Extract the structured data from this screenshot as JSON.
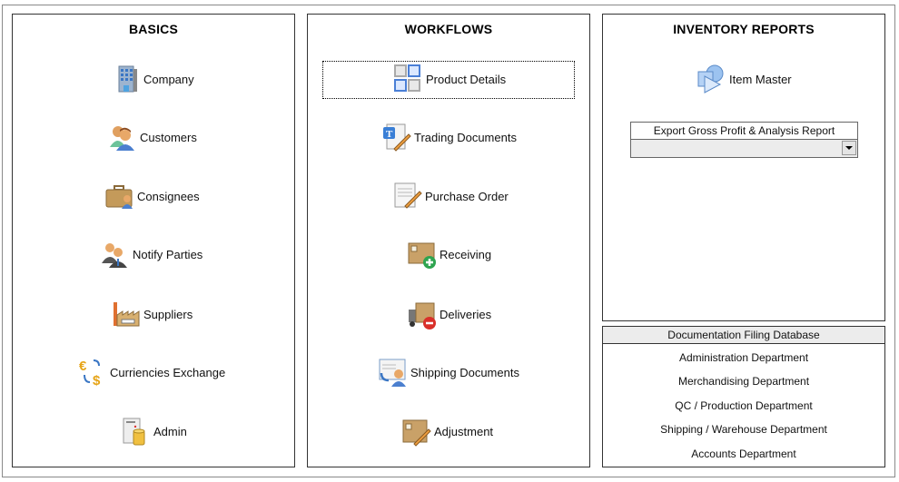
{
  "basics": {
    "title": "BASICS",
    "items": [
      {
        "label": "Company",
        "icon": "building-icon"
      },
      {
        "label": "Customers",
        "icon": "users-icon"
      },
      {
        "label": "Consignees",
        "icon": "briefcase-user-icon"
      },
      {
        "label": "Notify Parties",
        "icon": "business-people-icon"
      },
      {
        "label": "Suppliers",
        "icon": "factory-icon"
      },
      {
        "label": "Curriencies Exchange",
        "icon": "currency-exchange-icon"
      },
      {
        "label": "Admin",
        "icon": "server-database-icon"
      }
    ]
  },
  "workflows": {
    "title": "WORKFLOWS",
    "items": [
      {
        "label": "Product Details",
        "icon": "grid-squares-icon",
        "focused": true
      },
      {
        "label": "Trading Documents",
        "icon": "text-document-edit-icon"
      },
      {
        "label": "Purchase Order",
        "icon": "contract-pencil-icon"
      },
      {
        "label": "Receiving",
        "icon": "box-add-icon"
      },
      {
        "label": "Deliveries",
        "icon": "truck-remove-icon"
      },
      {
        "label": "Shipping Documents",
        "icon": "document-user-arrow-icon"
      },
      {
        "label": "Adjustment",
        "icon": "box-pencil-icon"
      }
    ]
  },
  "reports": {
    "title": "INVENTORY REPORTS",
    "item_master": {
      "label": "Item Master",
      "icon": "shapes-icon"
    },
    "export_combo": {
      "label": "Export Gross Profit & Analysis Report",
      "value": ""
    }
  },
  "docs": {
    "title": "Documentation Filing Database",
    "departments": [
      "Administration Department",
      "Merchandising Department",
      "QC / Production Department",
      "Shipping / Warehouse Department",
      "Accounts Department"
    ]
  }
}
